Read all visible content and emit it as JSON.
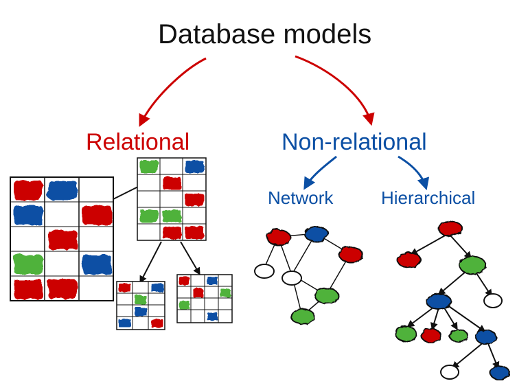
{
  "title": "Database models",
  "branches": {
    "relational": {
      "label": "Relational",
      "color": "#cc0000"
    },
    "nonrelational": {
      "label": "Non-relational",
      "color": "#0b4fa4",
      "children": {
        "network": {
          "label": "Network",
          "color": "#0b4fa4"
        },
        "hierarchical": {
          "label": "Hierarchical",
          "color": "#0b4fa4"
        }
      }
    }
  },
  "colors": {
    "red": "#cc0000",
    "blue": "#0b4fa4",
    "green": "#4fb23a",
    "black": "#111",
    "pageBg": "#ffffff"
  }
}
